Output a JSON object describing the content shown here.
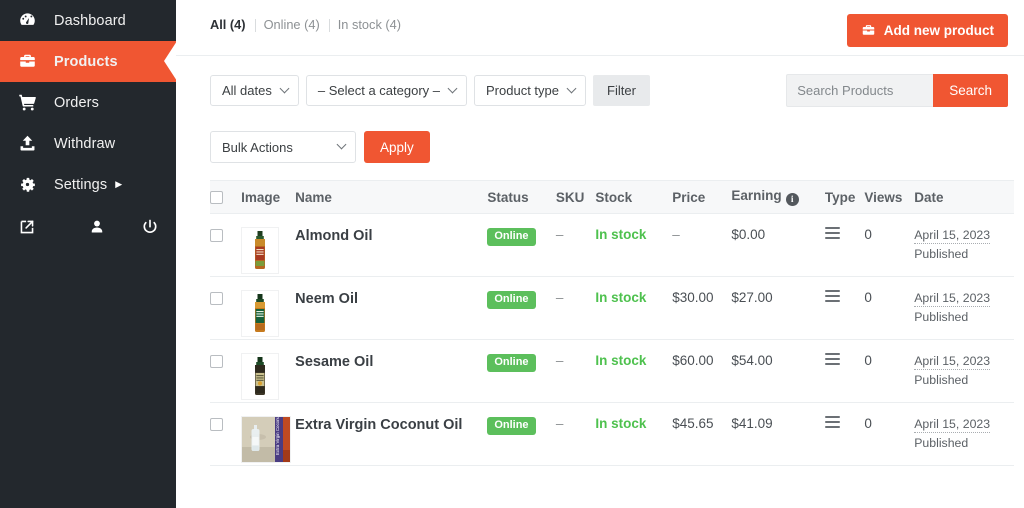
{
  "colors": {
    "accent": "#f05632",
    "sidebar_bg": "#23282d",
    "badge_green": "#5cbf5c",
    "instock_green": "#4ec14e"
  },
  "sidebar": {
    "items": [
      {
        "label": "Dashboard",
        "icon": "dashboard-icon",
        "active": false,
        "has_caret": false
      },
      {
        "label": "Products",
        "icon": "toolbox-icon",
        "active": true,
        "has_caret": false
      },
      {
        "label": "Orders",
        "icon": "cart-icon",
        "active": false,
        "has_caret": false
      },
      {
        "label": "Withdraw",
        "icon": "upload-icon",
        "active": false,
        "has_caret": false
      },
      {
        "label": "Settings",
        "icon": "gear-icon",
        "active": false,
        "has_caret": true
      }
    ],
    "footer_icons": [
      "external-link-icon",
      "user-icon",
      "power-icon"
    ]
  },
  "topbar": {
    "tabs": [
      {
        "label": "All (4)",
        "active": true
      },
      {
        "label": "Online (4)",
        "active": false
      },
      {
        "label": "In stock (4)",
        "active": false
      }
    ],
    "add_button": "Add new product"
  },
  "filters": {
    "date_select": "All dates",
    "category_select": "– Select a category –",
    "type_select": "Product type",
    "filter_button": "Filter"
  },
  "search": {
    "placeholder": "Search Products",
    "value": "",
    "button": "Search"
  },
  "bulk": {
    "select": "Bulk Actions",
    "apply_button": "Apply"
  },
  "table": {
    "headers": {
      "image": "Image",
      "name": "Name",
      "status": "Status",
      "sku": "SKU",
      "stock": "Stock",
      "price": "Price",
      "earning": "Earning",
      "type": "Type",
      "views": "Views",
      "date": "Date"
    },
    "rows": [
      {
        "name": "Almond Oil",
        "status": "Online",
        "sku": "–",
        "stock": "In stock",
        "price": "–",
        "earning": "$0.00",
        "views": "0",
        "date": "April 15, 2023",
        "date_status": "Published",
        "thumb": "almond-oil-bottle"
      },
      {
        "name": "Neem Oil",
        "status": "Online",
        "sku": "–",
        "stock": "In stock",
        "price": "$30.00",
        "earning": "$27.00",
        "views": "0",
        "date": "April 15, 2023",
        "date_status": "Published",
        "thumb": "neem-oil-bottle"
      },
      {
        "name": "Sesame Oil",
        "status": "Online",
        "sku": "–",
        "stock": "In stock",
        "price": "$60.00",
        "earning": "$54.00",
        "views": "0",
        "date": "April 15, 2023",
        "date_status": "Published",
        "thumb": "sesame-oil-bottle"
      },
      {
        "name": "Extra Virgin Coconut Oil",
        "status": "Online",
        "sku": "–",
        "stock": "In stock",
        "price": "$45.65",
        "earning": "$41.09",
        "views": "0",
        "date": "April 15, 2023",
        "date_status": "Published",
        "thumb": "coconut-oil-bottle"
      }
    ]
  }
}
